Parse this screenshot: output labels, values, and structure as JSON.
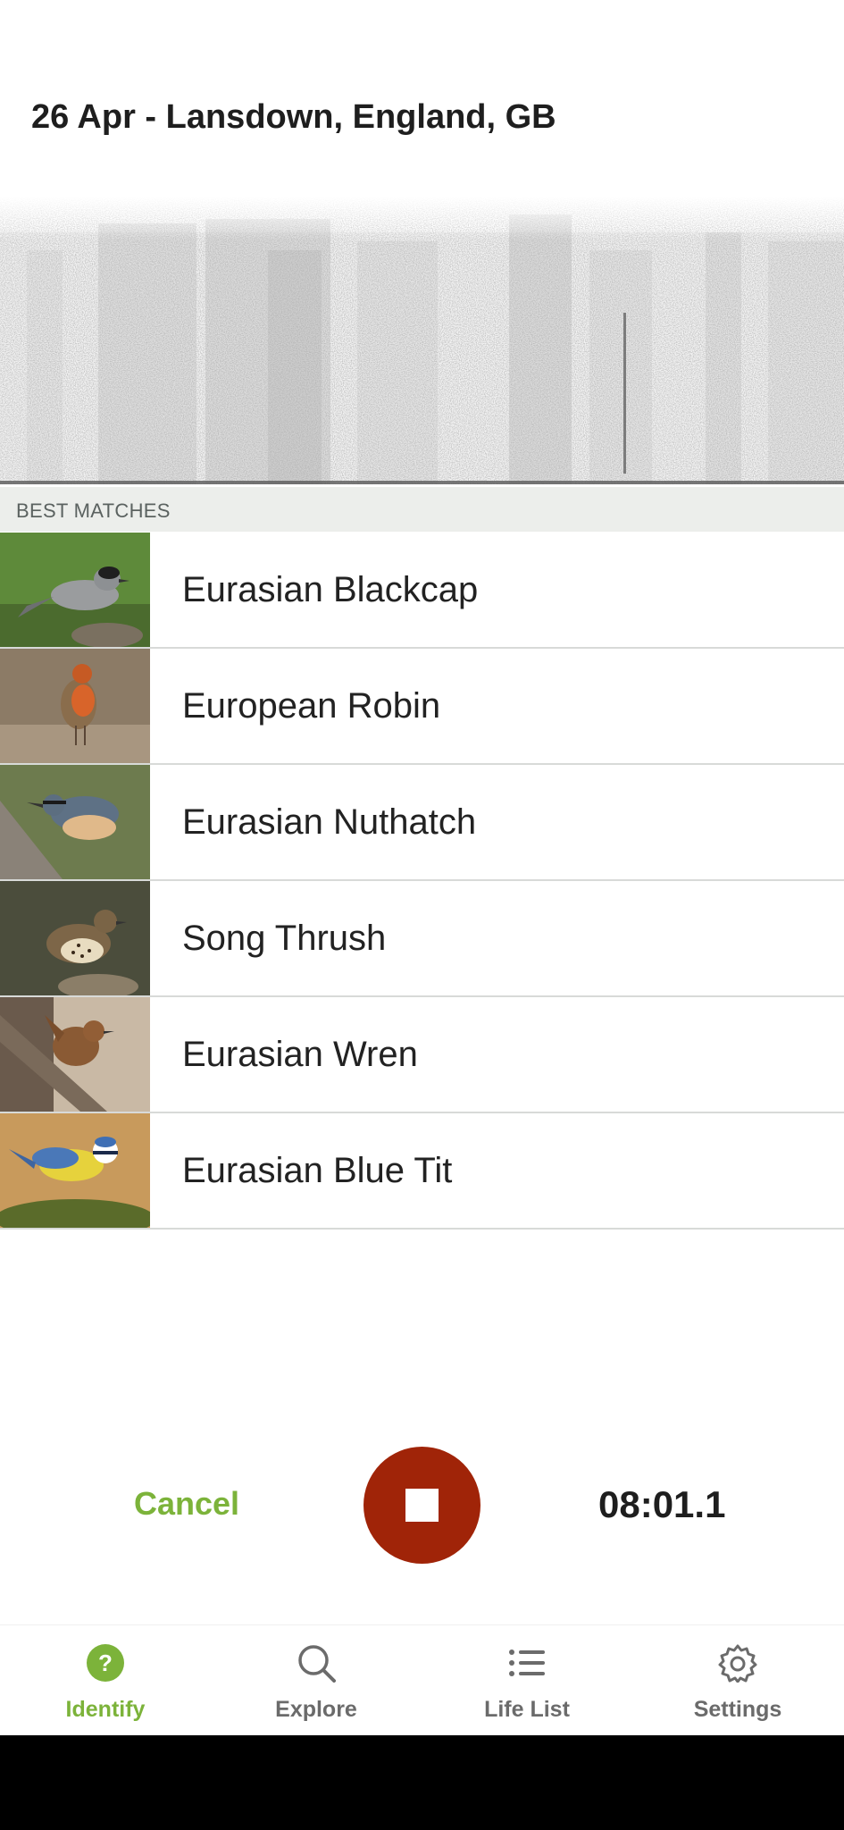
{
  "header": {
    "title": "26 Apr - Lansdown, England, GB"
  },
  "section": {
    "best_matches_label": "BEST MATCHES"
  },
  "matches": [
    {
      "name": "Eurasian Blackcap"
    },
    {
      "name": "European Robin"
    },
    {
      "name": "Eurasian Nuthatch"
    },
    {
      "name": "Song Thrush"
    },
    {
      "name": "Eurasian Wren"
    },
    {
      "name": "Eurasian Blue Tit"
    }
  ],
  "controls": {
    "cancel_label": "Cancel",
    "timer": "08:01.1"
  },
  "bottom_nav": {
    "items": [
      {
        "label": "Identify",
        "icon": "question-circle-icon",
        "active": true
      },
      {
        "label": "Explore",
        "icon": "search-icon",
        "active": false
      },
      {
        "label": "Life List",
        "icon": "list-icon",
        "active": false
      },
      {
        "label": "Settings",
        "icon": "gear-icon",
        "active": false
      }
    ]
  },
  "colors": {
    "accent_green": "#7cb33a",
    "stop_red": "#a02408",
    "section_bg": "#eceeeb"
  }
}
